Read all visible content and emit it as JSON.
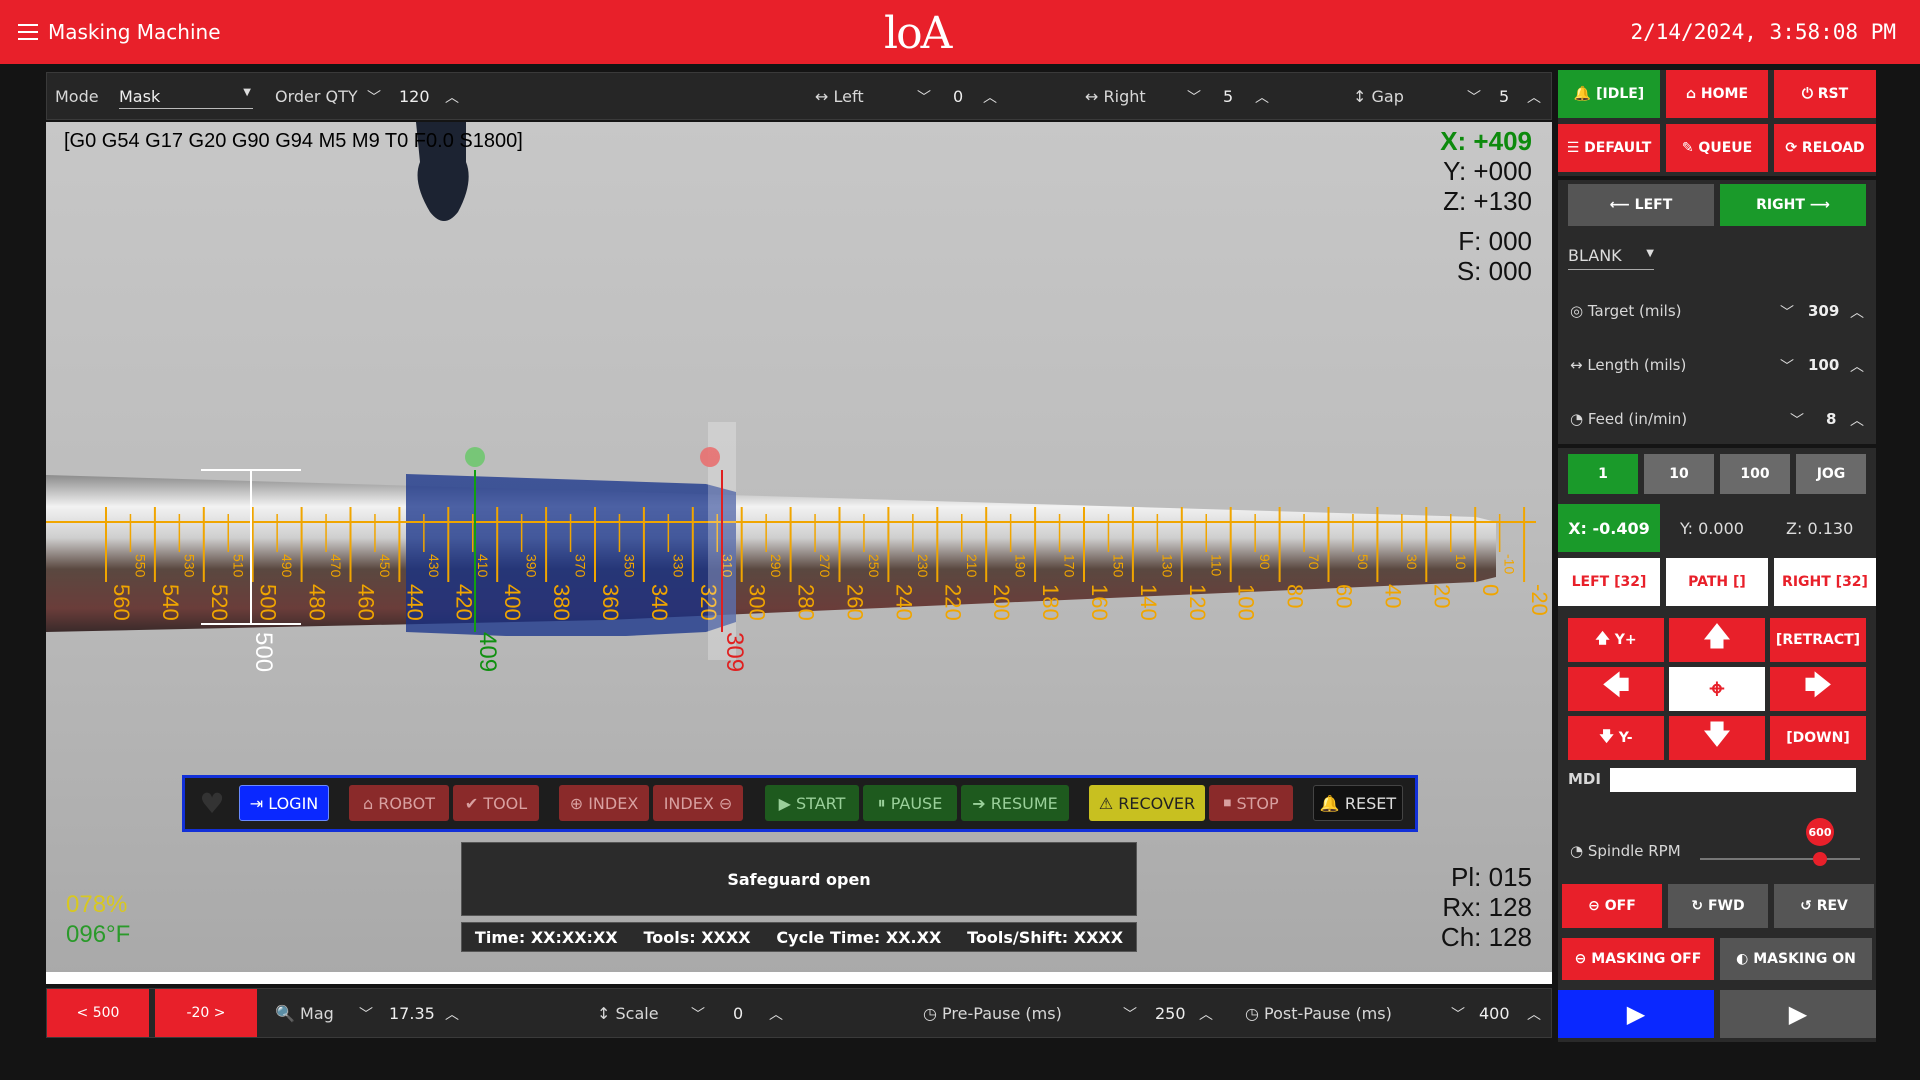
{
  "header": {
    "title": "Masking Machine",
    "logo": "loA",
    "datetime": "2/14/2024, 3:58:08 PM"
  },
  "top_toolbar": {
    "mode_label": "Mode",
    "mode_value": "Mask",
    "qty_label": "Order QTY",
    "qty_value": "120",
    "left_label": "Left",
    "left_value": "0",
    "right_label": "Right",
    "right_value": "5",
    "gap_label": "Gap",
    "gap_value": "5"
  },
  "viewport": {
    "gcode": "[G0 G54 G17 G20 G90 G94 M5 M9 T0 F0.0 S1800]",
    "x": "X: +409",
    "y": "Y: +000",
    "z": "Z: +130",
    "f": "F: 000",
    "s": "S: 000",
    "pl": "Pl: 015",
    "rx": "Rx: 128",
    "ch": "Ch: 128",
    "pct": "078%",
    "temp": "096°F",
    "marker_white": "500",
    "marker_green": "409",
    "marker_red": "309",
    "ruler_major": [
      "560",
      "540",
      "520",
      "500",
      "480",
      "460",
      "440",
      "420",
      "400",
      "380",
      "360",
      "340",
      "320",
      "300",
      "280",
      "260",
      "240",
      "220",
      "200",
      "180",
      "160",
      "140",
      "120",
      "100",
      "80",
      "60",
      "40",
      "20",
      "0",
      "-20"
    ],
    "ruler_minor": [
      "550",
      "530",
      "510",
      "490",
      "470",
      "450",
      "430",
      "410",
      "390",
      "370",
      "350",
      "330",
      "310",
      "290",
      "270",
      "250",
      "230",
      "210",
      "190",
      "170",
      "150",
      "130",
      "110",
      "90",
      "70",
      "50",
      "30",
      "10",
      "-10"
    ]
  },
  "control_bar": {
    "login": "LOGIN",
    "robot": "ROBOT",
    "tool": "TOOL",
    "index1": "INDEX",
    "index2": "INDEX",
    "start": "START",
    "pause": "PAUSE",
    "resume": "RESUME",
    "recover": "RECOVER",
    "stop": "STOP",
    "reset": "RESET"
  },
  "status": {
    "message": "Safeguard open",
    "time": "Time: XX:XX:XX",
    "tools": "Tools: XXXX",
    "cycle": "Cycle Time: XX.XX",
    "tools_shift": "Tools/Shift: XXXX"
  },
  "bottom_toolbar": {
    "prev": "< 500",
    "next": "-20 >",
    "mag_label": "Mag",
    "mag_value": "17.35",
    "scale_label": "Scale",
    "scale_value": "0",
    "prepause_label": "Pre-Pause (ms)",
    "prepause_value": "250",
    "postpause_label": "Post-Pause (ms)",
    "postpause_value": "400"
  },
  "right_panel": {
    "idle": "[IDLE]",
    "home": "HOME",
    "rst": "RST",
    "default": "DEFAULT",
    "queue": "QUEUE",
    "reload": "RELOAD",
    "left": "LEFT",
    "right": "RIGHT",
    "blank": "BLANK",
    "target_label": "Target (mils)",
    "target_value": "309",
    "length_label": "Length (mils)",
    "length_value": "100",
    "feed_label": "Feed (in/min)",
    "feed_value": "8",
    "step1": "1",
    "step10": "10",
    "step100": "100",
    "jog": "JOG",
    "x": "X:  -0.409",
    "y": "Y:  0.000",
    "z": "Z:  0.130",
    "left32": "LEFT [32]",
    "path": "PATH []",
    "right32": "RIGHT [32]",
    "yplus": "Y+",
    "retract": "[RETRACT]",
    "yminus": "Y-",
    "down": "[DOWN]",
    "mdi": "MDI",
    "spindle_label": "Spindle RPM",
    "spindle_value": "600",
    "spindle_fraction": 0.75,
    "off": "OFF",
    "fwd": "FWD",
    "rev": "REV",
    "mask_off": "MASKING OFF",
    "mask_on": "MASKING ON"
  },
  "colors": {
    "accent": "#e8202a",
    "green": "#1a9a2a",
    "blue": "#0a28ff",
    "ruler": "#f0a500"
  }
}
